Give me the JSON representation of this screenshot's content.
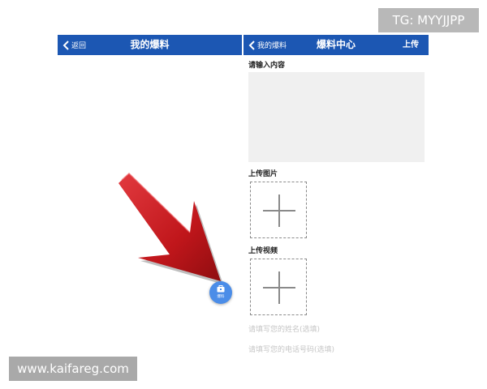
{
  "watermarks": {
    "tg": "TG: MYYJJPP",
    "site": "www.kaifareg.com"
  },
  "left_screen": {
    "back_label": "返回",
    "title": "我的爆料",
    "fab_label": "爆料"
  },
  "right_screen": {
    "back_label": "我的爆料",
    "title": "爆料中心",
    "action_label": "上传",
    "content_label": "请输入内容",
    "image_label": "上传图片",
    "video_label": "上传视频",
    "name_placeholder": "请填写您的姓名(选填)",
    "phone_placeholder": "请填写您的电话号码(选填)"
  },
  "colors": {
    "navbar": "#1c57b3",
    "fab": "#4b8de8",
    "arrow": "#c0161b"
  }
}
